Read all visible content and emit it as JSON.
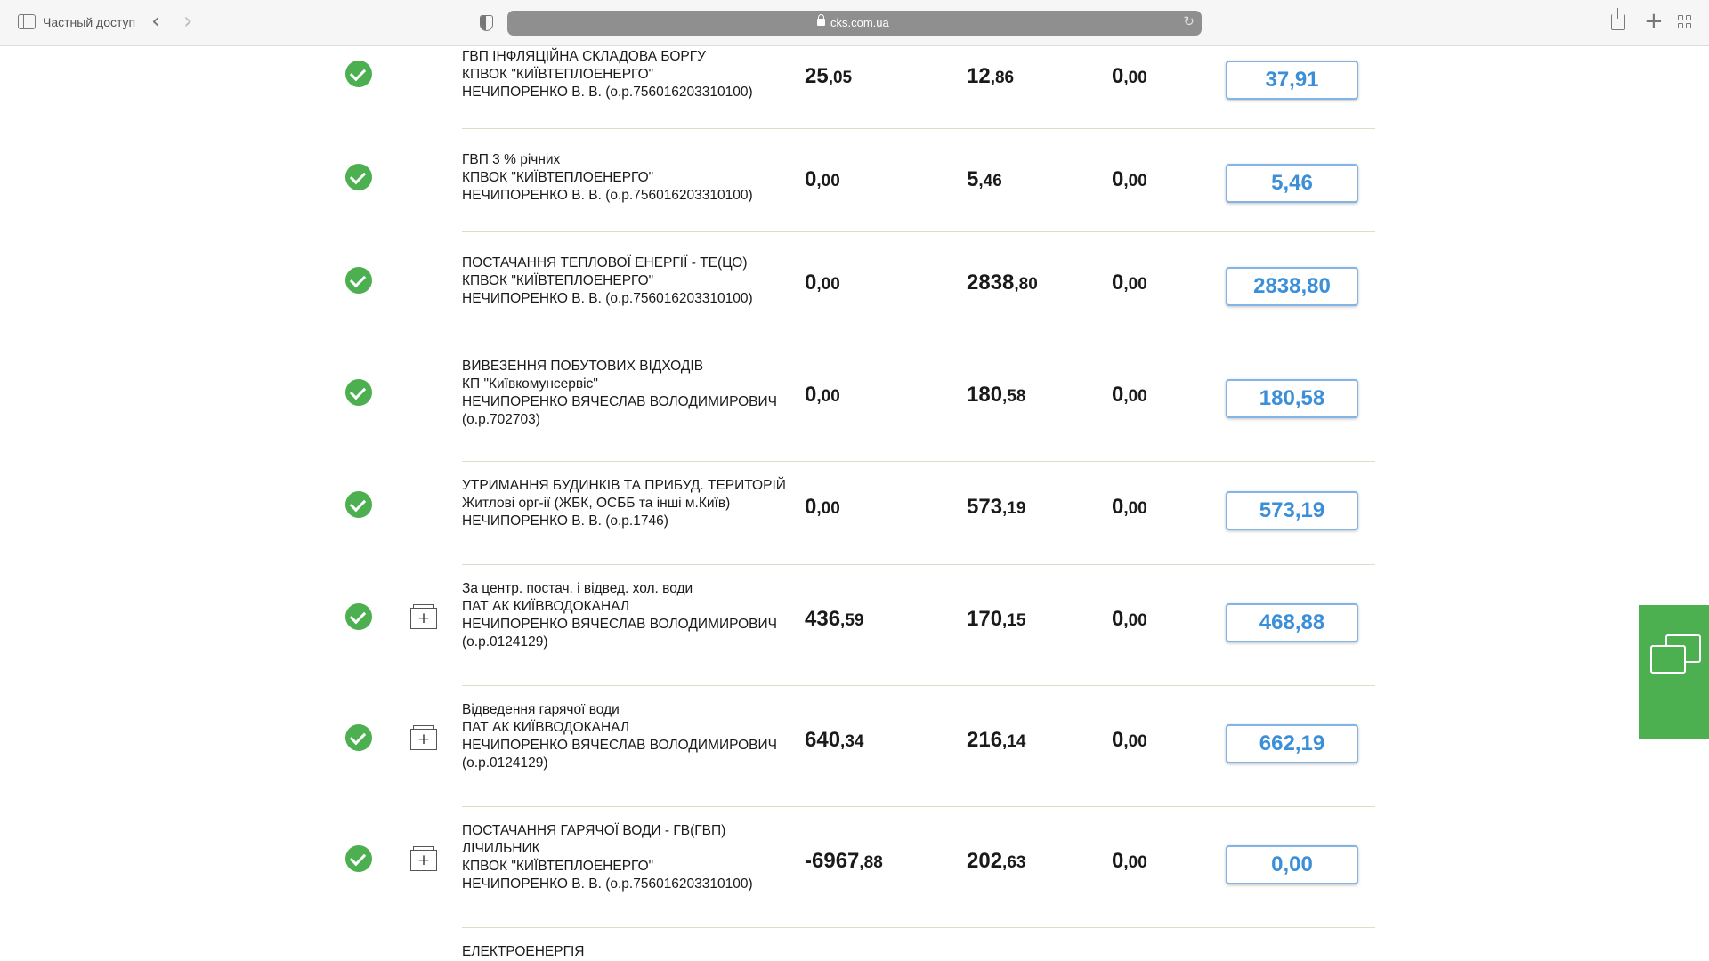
{
  "browser": {
    "private_label": "Частный доступ",
    "url": "cks.com.ua"
  },
  "rows": [
    {
      "lines": [
        "ГВП ІНФЛЯЦІЙНА СКЛАДОВА БОРГУ",
        "КПВОК \"КИЇВТЕПЛОЕНЕРГО\"",
        "НЕЧИПОРЕНКО В. В. (о.р.756016203310100)"
      ],
      "debt_int": "25",
      "debt_frac": ",05",
      "accrued_int": "12",
      "accrued_frac": ",86",
      "paid_int": "0",
      "paid_frac": ",00",
      "to_pay": "37,91",
      "has_details": false
    },
    {
      "lines": [
        "ГВП 3 % річних",
        "КПВОК \"КИЇВТЕПЛОЕНЕРГО\"",
        "НЕЧИПОРЕНКО В. В. (о.р.756016203310100)"
      ],
      "debt_int": "0",
      "debt_frac": ",00",
      "accrued_int": "5",
      "accrued_frac": ",46",
      "paid_int": "0",
      "paid_frac": ",00",
      "to_pay": "5,46",
      "has_details": false
    },
    {
      "lines": [
        "ПОСТАЧАННЯ ТЕПЛОВОЇ ЕНЕРГІЇ - ТЕ(ЦО)",
        "КПВОК \"КИЇВТЕПЛОЕНЕРГО\"",
        "НЕЧИПОРЕНКО В. В. (о.р.756016203310100)"
      ],
      "debt_int": "0",
      "debt_frac": ",00",
      "accrued_int": "2838",
      "accrued_frac": ",80",
      "paid_int": "0",
      "paid_frac": ",00",
      "to_pay": "2838,80",
      "has_details": false
    },
    {
      "lines": [
        "ВИВЕЗЕННЯ ПОБУТОВИХ ВІДХОДІВ",
        "КП \"Київкомунсервіс\"",
        "НЕЧИПОРЕНКО ВЯЧЕСЛАВ ВОЛОДИМИРОВИЧ",
        "(о.р.702703)"
      ],
      "debt_int": "0",
      "debt_frac": ",00",
      "accrued_int": "180",
      "accrued_frac": ",58",
      "paid_int": "0",
      "paid_frac": ",00",
      "to_pay": "180,58",
      "has_details": false
    },
    {
      "lines": [
        "УТРИМАННЯ БУДИНКІВ ТА ПРИБУД. ТЕРИТОРІЙ",
        "Житлові орг-ії (ЖБК, ОСББ та інші м.Київ)",
        "НЕЧИПОРЕНКО В. В. (о.р.1746)"
      ],
      "debt_int": "0",
      "debt_frac": ",00",
      "accrued_int": "573",
      "accrued_frac": ",19",
      "paid_int": "0",
      "paid_frac": ",00",
      "to_pay": "573,19",
      "has_details": false
    },
    {
      "lines": [
        "За центр. постач. і відвед. хол. води",
        "ПАТ АК КИЇВВОДОКАНАЛ",
        "НЕЧИПОРЕНКО ВЯЧЕСЛАВ ВОЛОДИМИРОВИЧ",
        "(о.р.0124129)"
      ],
      "debt_int": "436",
      "debt_frac": ",59",
      "accrued_int": "170",
      "accrued_frac": ",15",
      "paid_int": "0",
      "paid_frac": ",00",
      "to_pay": "468,88",
      "has_details": true
    },
    {
      "lines": [
        "Відведення гарячої води",
        "ПАТ АК КИЇВВОДОКАНАЛ",
        "НЕЧИПОРЕНКО ВЯЧЕСЛАВ ВОЛОДИМИРОВИЧ",
        "(о.р.0124129)"
      ],
      "debt_int": "640",
      "debt_frac": ",34",
      "accrued_int": "216",
      "accrued_frac": ",14",
      "paid_int": "0",
      "paid_frac": ",00",
      "to_pay": "662,19",
      "has_details": true
    },
    {
      "lines": [
        "ПОСТАЧАННЯ ГАРЯЧОЇ ВОДИ - ГВ(ГВП)",
        "ЛІЧИЛЬНИК",
        "КПВОК \"КИЇВТЕПЛОЕНЕРГО\"",
        "НЕЧИПОРЕНКО В. В. (о.р.756016203310100)"
      ],
      "debt_int": "-6967",
      "debt_frac": ",88",
      "accrued_int": "202",
      "accrued_frac": ",63",
      "paid_int": "0",
      "paid_frac": ",00",
      "to_pay": "0,00",
      "has_details": true
    },
    {
      "lines": [
        "ЕЛЕКТРОЕНЕРГІЯ"
      ],
      "debt_int": "",
      "debt_frac": "",
      "accrued_int": "",
      "accrued_frac": "",
      "paid_int": "",
      "paid_frac": "",
      "to_pay": "",
      "has_details": true
    }
  ],
  "colors": {
    "check_green": "#4caf50",
    "amount_blue": "#3b8fd9",
    "chat_green": "#4caf50"
  },
  "icons": {
    "paid": "check-circle-icon",
    "details": "add-details-icon",
    "chat": "chat-bubbles-icon"
  }
}
